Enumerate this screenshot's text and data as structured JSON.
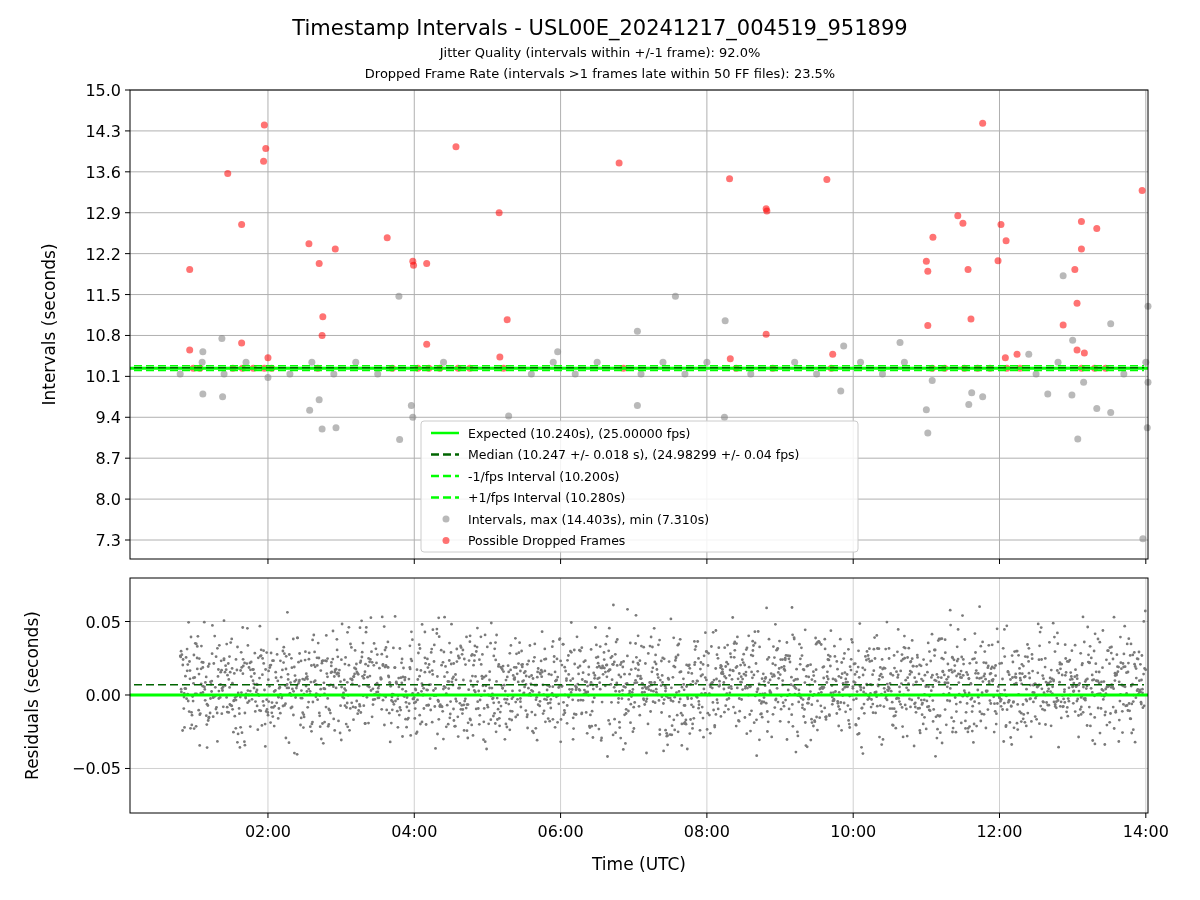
{
  "figure": {
    "title": "Timestamp Intervals - USL00E_20241217_004519_951899",
    "subtitle_lines": [
      "Jitter Quality (intervals within +/-1 frame): 92.0%",
      "Dropped Frame Rate (intervals >1 frames late within 50 FF files): 23.5%"
    ]
  },
  "interval_plot": {
    "chart_data": {
      "type": "scatter",
      "ylabel": "Intervals (seconds)",
      "xlim": [
        0.114,
        14.03
      ],
      "ylim": [
        6.975,
        15.0
      ],
      "grid": true,
      "yticks": [
        {
          "value": 7.3,
          "label": "7.3"
        },
        {
          "value": 8,
          "label": "8.0"
        },
        {
          "value": 8.7,
          "label": "8.7"
        },
        {
          "value": 9.4,
          "label": "9.4"
        },
        {
          "value": 10.1,
          "label": "10.1"
        },
        {
          "value": 10.8,
          "label": "10.8"
        },
        {
          "value": 11.5,
          "label": "11.5"
        },
        {
          "value": 12.2,
          "label": "12.2"
        },
        {
          "value": 12.9,
          "label": "12.9"
        },
        {
          "value": 13.6,
          "label": "13.6"
        },
        {
          "value": 14.3,
          "label": "14.3"
        },
        {
          "value": 15,
          "label": "15.0"
        }
      ],
      "ref_lines": [
        {
          "axis": "y",
          "value": 10.24,
          "label": "Expected (10.240s), (25.00000 fps)",
          "color": "#00ff00"
        },
        {
          "axis": "y",
          "value": 10.247,
          "label": "Median (10.247 +/- 0.018 s), (24.98299 +/- 0.04 fps)",
          "color": "#006400"
        },
        {
          "axis": "y",
          "value": 10.2,
          "label": "-1/fps Interval (10.200s)",
          "color": "#00ff00"
        },
        {
          "axis": "y",
          "value": 10.28,
          "label": "+1/fps Interval (10.280s)",
          "color": "#00ff00"
        }
      ],
      "legend": true,
      "series": [
        {
          "name": "Intervals, max (14.403s), min (7.310s)",
          "color": "#808080",
          "x": [
            0.8,
            1.1,
            1.4,
            1.7,
            2.3,
            2.6,
            2.9,
            3.2,
            3.5,
            4.4,
            5.6,
            5.9,
            6.2,
            6.5,
            7.1,
            7.4,
            7.7,
            8.0,
            8.6,
            9.2,
            9.5,
            10.1,
            10.4,
            10.7,
            12.5,
            12.8,
            13.7,
            14.0,
            1.11,
            1.38,
            1.11,
            1.37,
            2.0,
            2.57,
            2.7,
            2.74,
            2.93,
            3.8,
            3.98,
            3.96,
            3.79,
            5.29,
            7.05,
            7.05,
            7.57,
            8.25,
            8.24,
            5.96,
            9.83,
            9.87,
            10.64,
            11.0,
            11.02,
            11.08,
            11.58,
            11.62,
            11.77,
            12.4,
            12.66,
            12.87,
            13.0,
            13.07,
            12.99,
            13.15,
            13.33,
            13.52,
            13.52,
            14.03,
            14.02,
            13.96,
            14.03
          ],
          "values": [
            10.14,
            10.34,
            10.14,
            10.34,
            10.14,
            10.34,
            10.14,
            10.34,
            10.14,
            10.34,
            10.14,
            10.34,
            10.14,
            10.34,
            10.14,
            10.34,
            10.14,
            10.34,
            10.14,
            10.34,
            10.14,
            10.34,
            10.14,
            10.34,
            10.14,
            10.34,
            10.14,
            10.34,
            9.8,
            9.75,
            10.52,
            10.75,
            10.08,
            9.52,
            9.7,
            9.2,
            9.22,
            9.02,
            9.4,
            9.6,
            11.47,
            9.42,
            9.6,
            10.87,
            11.47,
            11.05,
            9.4,
            10.52,
            9.85,
            10.62,
            10.68,
            9.53,
            9.13,
            10.03,
            9.62,
            9.82,
            9.75,
            10.48,
            9.8,
            11.82,
            10.72,
            9.03,
            9.78,
            10.0,
            9.55,
            9.48,
            11.0,
            11.3,
            9.22,
            7.32,
            10.0
          ]
        },
        {
          "name": "Possible Dropped Frames",
          "color": "#ff0000",
          "x": [
            0.93,
            0.93,
            1.45,
            1.64,
            1.64,
            1.95,
            1.97,
            1.94,
            2.0,
            2.56,
            2.7,
            2.75,
            2.74,
            2.92,
            3.63,
            3.98,
            3.99,
            4.17,
            4.17,
            4.57,
            5.16,
            5.17,
            5.27,
            6.8,
            8.31,
            8.32,
            8.81,
            8.82,
            8.81,
            9.64,
            9.72,
            11.0,
            11.02,
            11.02,
            11.09,
            11.43,
            11.5,
            11.57,
            11.61,
            11.77,
            11.98,
            12.02,
            12.09,
            12.08,
            12.24,
            12.87,
            13.03,
            13.06,
            13.06,
            13.12,
            13.12,
            13.16,
            13.33,
            13.95,
            0.98,
            1.07,
            1.52,
            1.65,
            1.8,
            1.95,
            2.05,
            2.68,
            3.7,
            4.05,
            4.2,
            4.35,
            4.6,
            4.76,
            5.22,
            6.86,
            8.4,
            8.9,
            9.7,
            11.08,
            11.25,
            11.52,
            11.7,
            11.87,
            12.1,
            12.28,
            13.12,
            13.3,
            13.45
          ],
          "values": [
            11.93,
            10.55,
            13.57,
            12.7,
            10.67,
            14.4,
            14.0,
            13.78,
            10.42,
            12.37,
            12.03,
            11.12,
            10.8,
            12.28,
            12.47,
            12.07,
            12.0,
            12.03,
            10.65,
            14.03,
            12.9,
            10.43,
            11.07,
            13.75,
            13.48,
            10.4,
            12.97,
            12.93,
            10.82,
            13.47,
            10.48,
            12.07,
            11.9,
            10.97,
            12.48,
            12.85,
            12.72,
            11.93,
            11.08,
            14.43,
            12.08,
            12.7,
            12.42,
            10.42,
            10.48,
            10.98,
            11.93,
            11.35,
            10.55,
            12.75,
            12.28,
            10.5,
            12.63,
            13.28,
            10.24,
            10.24,
            10.24,
            10.24,
            10.24,
            10.24,
            10.24,
            10.24,
            10.24,
            10.24,
            10.24,
            10.24,
            10.24,
            10.24,
            10.24,
            10.24,
            10.24,
            10.24,
            10.24,
            10.24,
            10.24,
            10.24,
            10.24,
            10.24,
            10.24,
            10.24,
            10.24,
            10.24,
            10.24
          ]
        }
      ]
    }
  },
  "residual_plot": {
    "chart_data": {
      "type": "scatter",
      "xlabel": "Time (UTC)",
      "ylabel": "Residuals (seconds)",
      "xlim": [
        0.114,
        14.03
      ],
      "ylim": [
        -0.0803,
        0.0796
      ],
      "xticks": [
        {
          "value": 2,
          "label": "02:00"
        },
        {
          "value": 4,
          "label": "04:00"
        },
        {
          "value": 6,
          "label": "06:00"
        },
        {
          "value": 8,
          "label": "08:00"
        },
        {
          "value": 10,
          "label": "10:00"
        },
        {
          "value": 12,
          "label": "12:00"
        },
        {
          "value": 14,
          "label": "14:00"
        }
      ],
      "yticks": [
        {
          "value": -0.05,
          "label": "−0.05"
        },
        {
          "value": 0,
          "label": "0.00"
        },
        {
          "value": 0.05,
          "label": "0.05"
        }
      ],
      "grid": true,
      "ref_lines": [
        {
          "axis": "y",
          "value": 0,
          "color": "#00ff00"
        },
        {
          "axis": "y",
          "value": 0.007,
          "color": "#006400"
        }
      ]
    }
  }
}
